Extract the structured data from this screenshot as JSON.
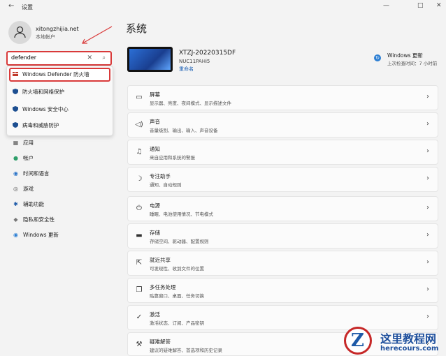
{
  "window": {
    "title": "设置",
    "back_glyph": "←",
    "min_glyph": "—",
    "max_glyph": "□",
    "close_glyph": "✕"
  },
  "account": {
    "name": "xitongzhijia.net",
    "sub": "本地帐户"
  },
  "search": {
    "value": "defender",
    "clear_glyph": "✕",
    "search_glyph": "⌕"
  },
  "search_results": [
    {
      "label": "Windows Defender 防火墙",
      "icon": "firewall-icon"
    },
    {
      "label": "防火墙和网络保护",
      "icon": "shield-icon"
    },
    {
      "label": "Windows 安全中心",
      "icon": "shield-icon"
    },
    {
      "label": "病毒和威胁防护",
      "icon": "shield-icon"
    }
  ],
  "sidebar": {
    "items": [
      {
        "label": "应用",
        "icon": "apps-icon",
        "glyph": "▦"
      },
      {
        "label": "帐户",
        "icon": "account-icon",
        "glyph": "●"
      },
      {
        "label": "时间和语言",
        "icon": "globe-icon",
        "glyph": "◉"
      },
      {
        "label": "游戏",
        "icon": "gamepad-icon",
        "glyph": "◎"
      },
      {
        "label": "辅助功能",
        "icon": "accessibility-icon",
        "glyph": "✱"
      },
      {
        "label": "隐私和安全性",
        "icon": "shield-icon",
        "glyph": "◆"
      },
      {
        "label": "Windows 更新",
        "icon": "update-icon",
        "glyph": "◉"
      }
    ]
  },
  "main": {
    "title": "系统",
    "device": {
      "name": "XTZJ-20220315DF",
      "model": "NUC11PAHi5",
      "rename": "重命名"
    },
    "update": {
      "title": "Windows 更新",
      "sub": "上次检查时间：7 小时前",
      "glyph": "↻"
    },
    "cards": [
      {
        "title": "屏幕",
        "sub": "显示器、亮度、夜间模式、显示描述文件",
        "icon": "monitor-icon",
        "glyph": "▭"
      },
      {
        "title": "声音",
        "sub": "音量级别、输出、输入、声音设备",
        "icon": "speaker-icon",
        "glyph": "◁)"
      },
      {
        "title": "通知",
        "sub": "来自应用和系统的警报",
        "icon": "bell-icon",
        "glyph": "♫"
      },
      {
        "title": "专注助手",
        "sub": "通知、自动规则",
        "icon": "moon-icon",
        "glyph": "☽"
      },
      {
        "title": "电源",
        "sub": "睡眠、电池使用情况、节电模式",
        "icon": "power-icon",
        "glyph": "⏻"
      },
      {
        "title": "存储",
        "sub": "存储空间、驱动器、配置规则",
        "icon": "storage-icon",
        "glyph": "▬"
      },
      {
        "title": "就近共享",
        "sub": "可发现性、收到文件的位置",
        "icon": "share-icon",
        "glyph": "⇱"
      },
      {
        "title": "多任务处理",
        "sub": "贴靠窗口、桌面、任务切换",
        "icon": "multitask-icon",
        "glyph": "❐"
      },
      {
        "title": "激活",
        "sub": "激活状态、订阅、产品密钥",
        "icon": "check-icon",
        "glyph": "✓"
      },
      {
        "title": "疑难解答",
        "sub": "建议的疑难解答、首选项和历史记录",
        "icon": "wrench-icon",
        "glyph": "⚒"
      }
    ],
    "chevron": "›"
  },
  "watermark": {
    "title": "这里教程网",
    "url": "herecours.com",
    "letter": "Z"
  },
  "colors": {
    "accent": "#1a5fb4",
    "highlight": "#d93a3a"
  }
}
